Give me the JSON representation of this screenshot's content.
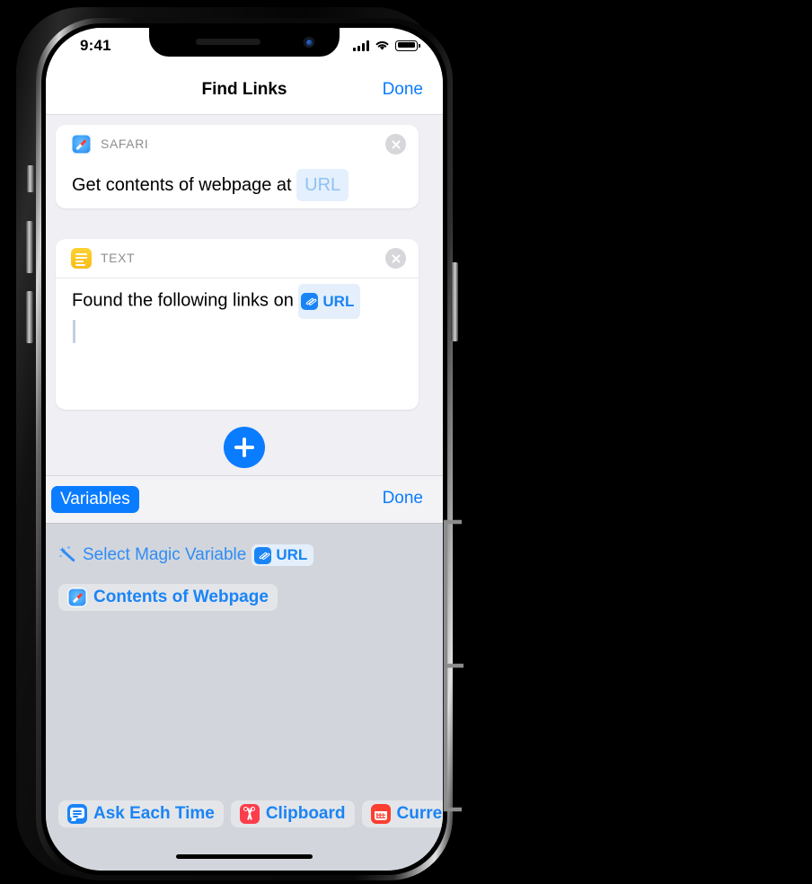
{
  "statusbar": {
    "time": "9:41",
    "signal_icon": "cellular-bars-icon",
    "wifi_icon": "wifi-icon",
    "battery_icon": "battery-full-icon"
  },
  "navbar": {
    "title": "Find Links",
    "done_label": "Done"
  },
  "workflow": {
    "actions": [
      {
        "app": "SAFARI",
        "app_icon": "safari-icon",
        "title_prefix": "Get contents of webpage at",
        "token": "URL",
        "close_icon": "close-circle-icon"
      },
      {
        "app": "TEXT",
        "app_icon": "text-icon",
        "body_prefix": "Found the following links on",
        "token": "URL",
        "token_icon": "link-chain-icon",
        "close_icon": "close-circle-icon"
      }
    ],
    "add_button_icon": "plus-icon"
  },
  "accessory": {
    "variables_label": "Variables",
    "done_label": "Done"
  },
  "variable_panel": {
    "magic_row": {
      "icon": "magic-wand-icon",
      "label": "Select Magic Variable",
      "token": "URL",
      "token_icon": "link-chain-icon"
    },
    "items": [
      {
        "icon": "safari-icon",
        "label": "Contents of Webpage"
      }
    ],
    "suggestions": [
      {
        "icon": "ask-each-time-icon",
        "label": "Ask Each Time"
      },
      {
        "icon": "clipboard-scissors-icon",
        "label": "Clipboard"
      },
      {
        "icon": "current-date-icon",
        "label": "Curre"
      }
    ]
  },
  "colors": {
    "accent_blue": "#0a7cff",
    "link_blue": "#1a84f5",
    "text_yellow": "#f9bc17",
    "clipboard_red": "#fc3d4a",
    "date_red": "#fc3d2f",
    "panel_bg": "#d2d6dc",
    "screen_bg": "#efeff4",
    "callout_gray": "#8c8c8c"
  }
}
